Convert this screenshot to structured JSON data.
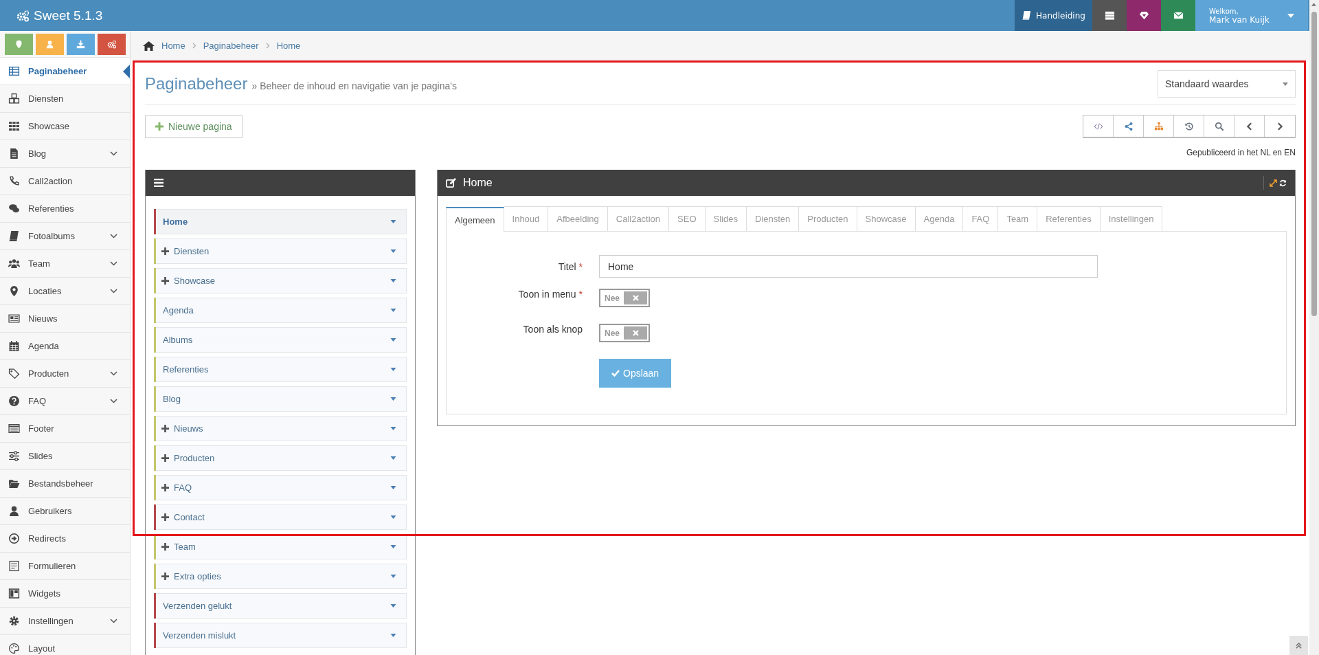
{
  "app": {
    "title": "Sweet 5.1.3"
  },
  "topbar_buttons": [
    {
      "kind": "manual",
      "label": "Handleiding",
      "color": "#2e6590"
    },
    {
      "kind": "server",
      "color": "#555555"
    },
    {
      "kind": "diamond",
      "color": "#8e2a6b"
    },
    {
      "kind": "mail",
      "color": "#2e8b57"
    }
  ],
  "user": {
    "greeting": "Welkom,",
    "name": "Mark van Kuijk"
  },
  "quick_buttons": [
    {
      "kind": "pin",
      "color": "#84b86f"
    },
    {
      "kind": "user",
      "color": "#f7b24a"
    },
    {
      "kind": "download",
      "color": "#5fa8dc"
    },
    {
      "kind": "gears",
      "color": "#d35440"
    }
  ],
  "sidebar": {
    "items": [
      {
        "label": "Paginabeheer",
        "selected": true,
        "expandable": false
      },
      {
        "label": "Diensten",
        "selected": false,
        "expandable": false
      },
      {
        "label": "Showcase",
        "selected": false,
        "expandable": false
      },
      {
        "label": "Blog",
        "selected": false,
        "expandable": true
      },
      {
        "label": "Call2action",
        "selected": false,
        "expandable": false
      },
      {
        "label": "Referenties",
        "selected": false,
        "expandable": false
      },
      {
        "label": "Fotoalbums",
        "selected": false,
        "expandable": true
      },
      {
        "label": "Team",
        "selected": false,
        "expandable": true
      },
      {
        "label": "Locaties",
        "selected": false,
        "expandable": true
      },
      {
        "label": "Nieuws",
        "selected": false,
        "expandable": false
      },
      {
        "label": "Agenda",
        "selected": false,
        "expandable": false
      },
      {
        "label": "Producten",
        "selected": false,
        "expandable": true
      },
      {
        "label": "FAQ",
        "selected": false,
        "expandable": true
      },
      {
        "label": "Footer",
        "selected": false,
        "expandable": false
      },
      {
        "label": "Slides",
        "selected": false,
        "expandable": false
      },
      {
        "label": "Bestandsbeheer",
        "selected": false,
        "expandable": false
      },
      {
        "label": "Gebruikers",
        "selected": false,
        "expandable": false
      },
      {
        "label": "Redirects",
        "selected": false,
        "expandable": false
      },
      {
        "label": "Formulieren",
        "selected": false,
        "expandable": false
      },
      {
        "label": "Widgets",
        "selected": false,
        "expandable": false
      },
      {
        "label": "Instellingen",
        "selected": false,
        "expandable": true
      },
      {
        "label": "Layout",
        "selected": false,
        "expandable": false
      }
    ]
  },
  "breadcrumb": [
    "Home",
    "Paginabeheer",
    "Home"
  ],
  "page": {
    "title": "Paginabeheer",
    "subtitle": "» Beheer de inhoud en navigatie van je pagina's",
    "preset_select": "Standaard waardes",
    "new_button": "Nieuwe pagina",
    "published_note": "Gepubliceerd in het NL en EN"
  },
  "toolbar": [
    {
      "kind": "code"
    },
    {
      "kind": "share"
    },
    {
      "kind": "sitemap"
    },
    {
      "kind": "history"
    },
    {
      "kind": "search"
    },
    {
      "kind": "prev"
    },
    {
      "kind": "next"
    }
  ],
  "tree": {
    "items": [
      {
        "label": "Home",
        "selected": true,
        "has_children": false,
        "color": "#b5474a"
      },
      {
        "label": "Diensten",
        "selected": false,
        "has_children": true,
        "color": "#c3c66a"
      },
      {
        "label": "Showcase",
        "selected": false,
        "has_children": true,
        "color": "#c3c66a"
      },
      {
        "label": "Agenda",
        "selected": false,
        "has_children": false,
        "color": "#c3c66a"
      },
      {
        "label": "Albums",
        "selected": false,
        "has_children": false,
        "color": "#c3c66a"
      },
      {
        "label": "Referenties",
        "selected": false,
        "has_children": false,
        "color": "#c3c66a"
      },
      {
        "label": "Blog",
        "selected": false,
        "has_children": false,
        "color": "#c3c66a"
      },
      {
        "label": "Nieuws",
        "selected": false,
        "has_children": true,
        "color": "#c3c66a"
      },
      {
        "label": "Producten",
        "selected": false,
        "has_children": true,
        "color": "#c3c66a"
      },
      {
        "label": "FAQ",
        "selected": false,
        "has_children": true,
        "color": "#c3c66a"
      },
      {
        "label": "Contact",
        "selected": false,
        "has_children": true,
        "color": "#b5474a"
      },
      {
        "label": "Team",
        "selected": false,
        "has_children": true,
        "color": "#c3c66a"
      },
      {
        "label": "Extra opties",
        "selected": false,
        "has_children": true,
        "color": "#c3c66a"
      },
      {
        "label": "Verzenden gelukt",
        "selected": false,
        "has_children": false,
        "color": "#b5474a"
      },
      {
        "label": "Verzenden mislukt",
        "selected": false,
        "has_children": false,
        "color": "#b5474a"
      }
    ]
  },
  "editor": {
    "title": "Home",
    "tabs": [
      {
        "label": "Algemeen",
        "selected": true
      },
      {
        "label": "Inhoud",
        "selected": false
      },
      {
        "label": "Afbeelding",
        "selected": false
      },
      {
        "label": "Call2action",
        "selected": false
      },
      {
        "label": "SEO",
        "selected": false
      },
      {
        "label": "Slides",
        "selected": false
      },
      {
        "label": "Diensten",
        "selected": false
      },
      {
        "label": "Producten",
        "selected": false
      },
      {
        "label": "Showcase",
        "selected": false
      },
      {
        "label": "Agenda",
        "selected": false
      },
      {
        "label": "FAQ",
        "selected": false
      },
      {
        "label": "Team",
        "selected": false
      },
      {
        "label": "Referenties",
        "selected": false
      },
      {
        "label": "Instellingen",
        "selected": false
      }
    ],
    "fields": [
      {
        "kind": "text",
        "label": "Titel",
        "required_mark": "*",
        "value": "Home"
      },
      {
        "kind": "toggle",
        "label": "Toon in menu",
        "required_mark": "*",
        "on": false,
        "state_label": "Nee"
      },
      {
        "kind": "toggle",
        "label": "Toon als knop",
        "on": false,
        "state_label": "Nee"
      }
    ],
    "save_button": "Opslaan"
  }
}
